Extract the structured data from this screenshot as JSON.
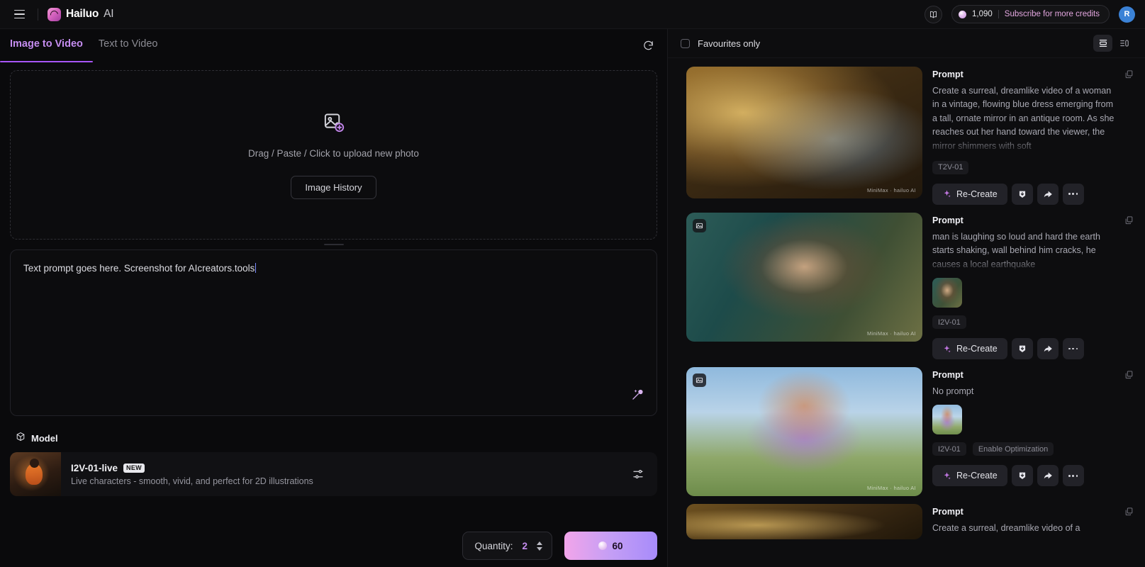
{
  "topbar": {
    "menu_icon": "hamburger-icon",
    "brand_name": "Hailuo",
    "brand_suffix": "AI",
    "tutorial_icon": "book-icon",
    "credits_amount": "1,090",
    "credits_link": "Subscribe for more credits",
    "avatar_initial": "R"
  },
  "left": {
    "tabs": [
      {
        "label": "Image to Video",
        "active": true
      },
      {
        "label": "Text to Video",
        "active": false
      }
    ],
    "refresh_icon": "refresh-icon",
    "dropzone": {
      "icon": "image-add-icon",
      "text": "Drag / Paste / Click to upload new photo",
      "button": "Image History"
    },
    "prompt": {
      "value": "Text prompt goes here. Screenshot for AIcreators.tools",
      "placeholder": "Text prompt goes here.",
      "optimize_icon": "magic-wand-icon"
    },
    "model": {
      "section_label": "Model",
      "section_icon": "cube-icon",
      "name": "I2V-01-live",
      "badge": "NEW",
      "description": "Live characters - smooth, vivid, and perfect for 2D illustrations",
      "settings_icon": "sliders-icon"
    },
    "footer": {
      "quantity_label": "Quantity:",
      "quantity_value": "2",
      "generate_cost": "60"
    }
  },
  "right": {
    "favourites_label": "Favourites only",
    "favourites_checked": false,
    "view_toggles": [
      {
        "name": "card-view-icon",
        "active": true
      },
      {
        "name": "list-view-icon",
        "active": false
      }
    ],
    "prompt_label": "Prompt",
    "recreate_label": "Re-Create",
    "watermark": "MiniMax · hailuo AI",
    "cards": [
      {
        "prompt": "Create a surreal, dreamlike video of a woman in a vintage, flowing blue dress emerging from a tall, ornate mirror in an antique room. As she reaches out her hand toward the viewer, the mirror shimmers with soft",
        "tags": [
          "T2V-01"
        ],
        "has_ref_thumb": false,
        "has_media_badge": false
      },
      {
        "prompt": "man is laughing so loud and hard the earth starts shaking, wall behind him cracks, he causes a local earthquake",
        "tags": [
          "I2V-01"
        ],
        "has_ref_thumb": true,
        "has_media_badge": true
      },
      {
        "prompt": "No prompt",
        "tags": [
          "I2V-01",
          "Enable Optimization"
        ],
        "has_ref_thumb": true,
        "has_media_badge": true
      },
      {
        "prompt": "Create a surreal, dreamlike video of a",
        "tags": [],
        "has_ref_thumb": false,
        "has_media_badge": false
      }
    ]
  }
}
